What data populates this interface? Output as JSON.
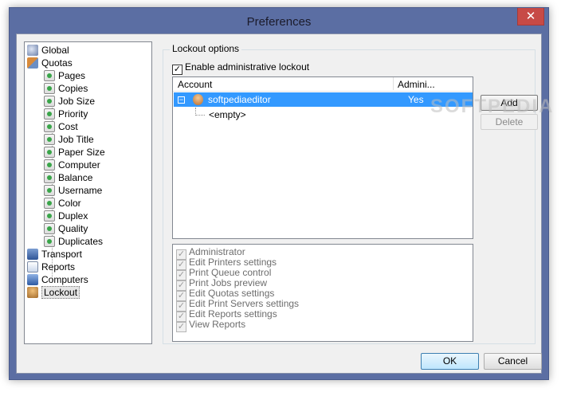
{
  "window": {
    "title": "Preferences",
    "close_glyph": "✕"
  },
  "tree": {
    "items": [
      {
        "label": "Global",
        "icon": "globe-icon"
      },
      {
        "label": "Quotas",
        "icon": "users-icon"
      },
      {
        "label": "Pages",
        "icon": "quota-item-icon"
      },
      {
        "label": "Copies",
        "icon": "quota-item-icon"
      },
      {
        "label": "Job Size",
        "icon": "quota-item-icon"
      },
      {
        "label": "Priority",
        "icon": "quota-item-icon"
      },
      {
        "label": "Cost",
        "icon": "quota-item-icon"
      },
      {
        "label": "Job Title",
        "icon": "quota-item-icon"
      },
      {
        "label": "Paper Size",
        "icon": "quota-item-icon"
      },
      {
        "label": "Computer",
        "icon": "quota-item-icon"
      },
      {
        "label": "Balance",
        "icon": "quota-item-icon"
      },
      {
        "label": "Username",
        "icon": "quota-item-icon"
      },
      {
        "label": "Color",
        "icon": "quota-item-icon"
      },
      {
        "label": "Duplex",
        "icon": "quota-item-icon"
      },
      {
        "label": "Quality",
        "icon": "quota-item-icon"
      },
      {
        "label": "Duplicates",
        "icon": "quota-item-icon"
      },
      {
        "label": "Transport",
        "icon": "transport-icon"
      },
      {
        "label": "Reports",
        "icon": "reports-icon"
      },
      {
        "label": "Computers",
        "icon": "computers-icon"
      },
      {
        "label": "Lockout",
        "icon": "lockout-icon",
        "selected": true
      }
    ]
  },
  "lockout": {
    "group_title": "Lockout options",
    "enable_label": "Enable administrative lockout",
    "enable_checked": true,
    "columns": {
      "account": "Account",
      "admin": "Admini..."
    },
    "rows": [
      {
        "expander": "−",
        "account": "softpediaeditor",
        "admin": "Yes",
        "selected": true
      },
      {
        "account": "<empty>"
      }
    ],
    "add_label": "Add",
    "delete_label": "Delete",
    "permissions": [
      "Administrator",
      "Edit Printers settings",
      "Print Queue control",
      "Print Jobs preview",
      "Edit Quotas settings",
      "Edit Print Servers settings",
      "Edit Reports settings",
      "View Reports"
    ]
  },
  "footer": {
    "ok_label": "OK",
    "cancel_label": "Cancel"
  },
  "watermark": "SOFTPEDIA"
}
